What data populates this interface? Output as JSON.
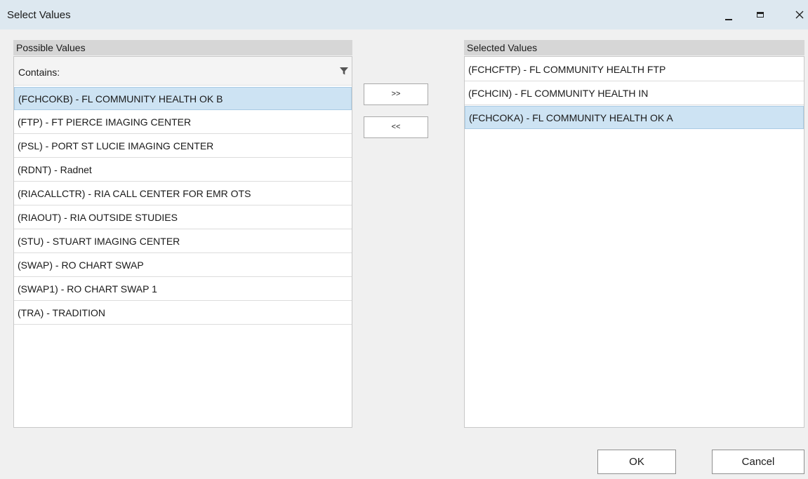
{
  "window": {
    "title": "Select Values"
  },
  "possible": {
    "header": "Possible Values",
    "filter_label": "Contains:",
    "filter_value": "",
    "items": [
      {
        "label": "(FCHCOKB) - FL COMMUNITY HEALTH OK B",
        "selected": true
      },
      {
        "label": "(FTP) - FT PIERCE IMAGING CENTER",
        "selected": false
      },
      {
        "label": "(PSL) - PORT ST LUCIE IMAGING CENTER",
        "selected": false
      },
      {
        "label": "(RDNT) - Radnet",
        "selected": false
      },
      {
        "label": "(RIACALLCTR) - RIA CALL CENTER FOR EMR OTS",
        "selected": false
      },
      {
        "label": "(RIAOUT) - RIA OUTSIDE STUDIES",
        "selected": false
      },
      {
        "label": "(STU) - STUART IMAGING CENTER",
        "selected": false
      },
      {
        "label": "(SWAP) - RO CHART SWAP",
        "selected": false
      },
      {
        "label": "(SWAP1) - RO CHART SWAP 1",
        "selected": false
      },
      {
        "label": "(TRA) - TRADITION",
        "selected": false
      }
    ]
  },
  "selected": {
    "header": "Selected Values",
    "items": [
      {
        "label": "(FCHCFTP) - FL COMMUNITY HEALTH FTP",
        "selected": false
      },
      {
        "label": "(FCHCIN) - FL COMMUNITY HEALTH IN",
        "selected": false
      },
      {
        "label": "(FCHCOKA) - FL COMMUNITY HEALTH OK A",
        "selected": true
      }
    ]
  },
  "actions": {
    "add_label": ">>",
    "remove_label": "<<",
    "ok_label": "OK",
    "cancel_label": "Cancel"
  },
  "colors": {
    "titlebar": "#dde8f0",
    "selection": "#cde3f3",
    "header": "#d6d6d6"
  }
}
